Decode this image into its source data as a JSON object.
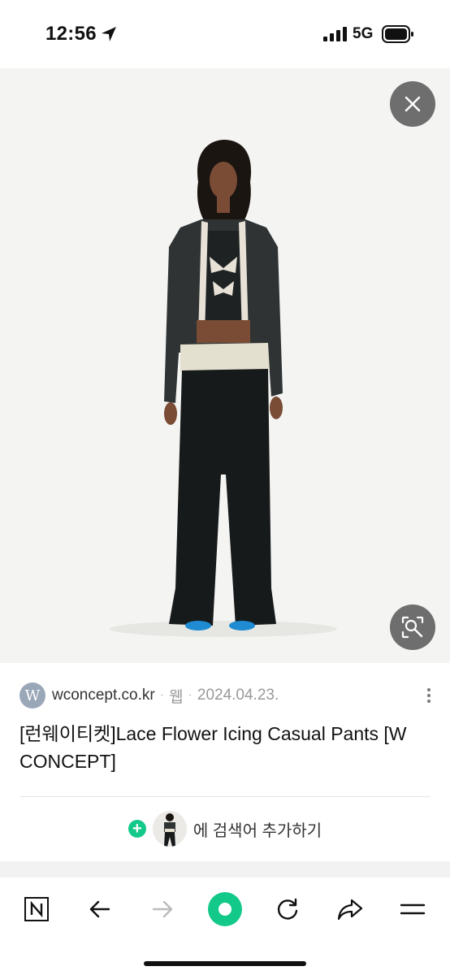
{
  "status_bar": {
    "time": "12:56",
    "network": "5G"
  },
  "viewer": {
    "close_icon": "close-icon",
    "lens_icon": "image-search-icon"
  },
  "result": {
    "favicon_letter": "W",
    "domain": "wconcept.co.kr",
    "separator": "·",
    "type": "웹",
    "date": "2024.04.23.",
    "title": "[런웨이티켓]Lace Flower Icing Casual Pants [W CONCEPT]",
    "add_text": "에 검색어 추가하기"
  },
  "toolbar": {
    "icons": [
      "naver-home-icon",
      "back-arrow-icon",
      "forward-arrow-icon",
      "green-dot-icon",
      "refresh-icon",
      "share-icon",
      "menu-icon"
    ]
  },
  "colors": {
    "accent_green": "#12c98a",
    "overlay_button": "#6e6e6e"
  }
}
